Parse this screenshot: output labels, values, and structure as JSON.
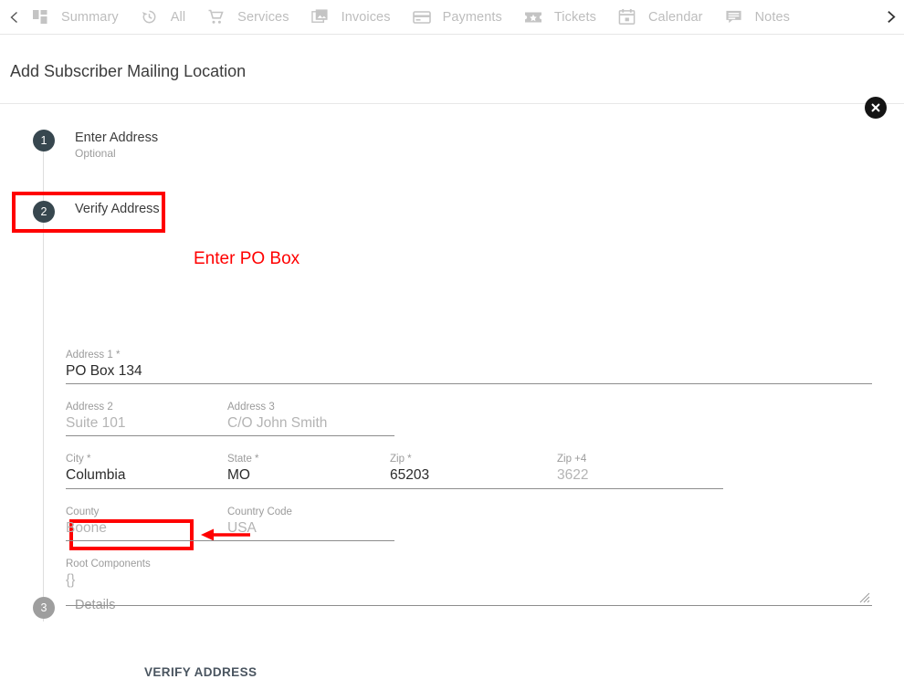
{
  "topnav": {
    "scroll_left_icon": "chevron-left-icon",
    "scroll_right_icon": "chevron-right-icon",
    "items": [
      {
        "label": "Summary",
        "icon": "dashboard-grid-icon"
      },
      {
        "label": "All",
        "icon": "history-clock-icon"
      },
      {
        "label": "Services",
        "icon": "shopping-cart-icon"
      },
      {
        "label": "Invoices",
        "icon": "photo-stack-icon"
      },
      {
        "label": "Payments",
        "icon": "credit-card-icon"
      },
      {
        "label": "Tickets",
        "icon": "ticket-star-icon"
      },
      {
        "label": "Calendar",
        "icon": "calendar-icon"
      },
      {
        "label": "Notes",
        "icon": "comment-lines-icon"
      }
    ]
  },
  "dialog": {
    "title": "Add Subscriber Mailing Location",
    "close_icon": "close-icon"
  },
  "stepper": {
    "steps": [
      {
        "number": "1",
        "title": "Enter Address",
        "subtitle": "Optional",
        "state": "active"
      },
      {
        "number": "2",
        "title": "Verify Address",
        "subtitle": "",
        "state": "active"
      },
      {
        "number": "3",
        "title": "Details",
        "subtitle": "",
        "state": "inactive"
      }
    ]
  },
  "form": {
    "address1": {
      "label": "Address 1 *",
      "value": "PO Box 134",
      "filled": true
    },
    "address2": {
      "label": "Address 2",
      "placeholder": "Suite 101",
      "filled": false
    },
    "address3": {
      "label": "Address 3",
      "placeholder": "C/O John Smith",
      "filled": false
    },
    "city": {
      "label": "City *",
      "value": "Columbia",
      "filled": true
    },
    "state": {
      "label": "State *",
      "value": "MO",
      "filled": true
    },
    "zip": {
      "label": "Zip *",
      "value": "65203",
      "filled": true
    },
    "zip4": {
      "label": "Zip +4",
      "placeholder": "3622",
      "filled": false
    },
    "county": {
      "label": "County",
      "placeholder": "Boone",
      "filled": false
    },
    "country": {
      "label": "Country Code",
      "placeholder": "USA",
      "filled": false
    },
    "root": {
      "label": "Root Components",
      "value": "{}",
      "filled": false
    },
    "verify_button": "VERIFY ADDRESS"
  },
  "annotations": {
    "enter_po_box": "Enter PO Box",
    "color": "#ff0000"
  }
}
